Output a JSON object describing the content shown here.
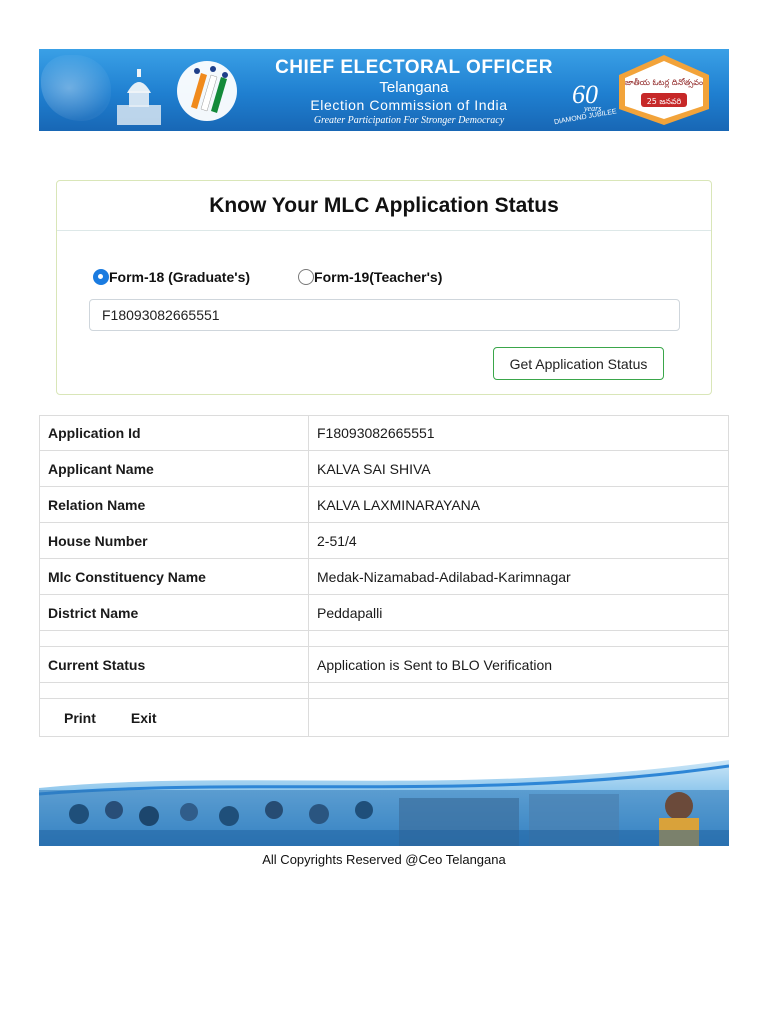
{
  "header": {
    "title": "CHIEF ELECTORAL OFFICER",
    "state": "Telangana",
    "commission": "Election Commission of India",
    "tagline": "Greater Participation For Stronger Democracy",
    "anniversary_number": "60",
    "anniversary_years": "years",
    "anniversary_label": "DIAMOND JUBILEE",
    "voters_day_text": "జాతీయ ఓటర్ల దినోత్సవం",
    "voters_day_date": "25 జనవరి"
  },
  "form": {
    "title": "Know Your MLC Application Status",
    "options": [
      {
        "label": "Form-18 (Graduate's)",
        "selected": true
      },
      {
        "label": "Form-19(Teacher's)",
        "selected": false
      }
    ],
    "application_input_value": "F18093082665551",
    "submit_label": "Get Application Status"
  },
  "details": {
    "rows": [
      {
        "key": "Application Id",
        "value": "F18093082665551"
      },
      {
        "key": "Applicant Name",
        "value": "KALVA SAI SHIVA"
      },
      {
        "key": "Relation Name",
        "value": "KALVA LAXMINARAYANA"
      },
      {
        "key": "House Number",
        "value": "2-51/4"
      },
      {
        "key": "Mlc Constituency Name",
        "value": "Medak-Nizamabad-Adilabad-Karimnagar"
      },
      {
        "key": "District Name",
        "value": "Peddapalli"
      }
    ],
    "status_key": "Current Status",
    "status_value": "Application is Sent to BLO Verification",
    "print_label": "Print",
    "exit_label": "Exit"
  },
  "footer": {
    "copyright": "All Copyrights Reserved @Ceo Telangana"
  },
  "colors": {
    "banner_blue": "#1f7fd0",
    "radio_selected": "#1a7be0",
    "button_border": "#3aa64a",
    "panel_border": "#d9e6b8"
  }
}
